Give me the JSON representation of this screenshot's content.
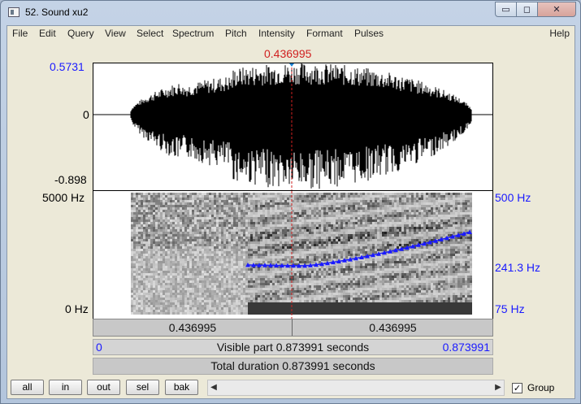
{
  "window": {
    "title": "52. Sound xu2",
    "buttons": {
      "minimize": "▭",
      "maximize": "◻",
      "close": "✕"
    }
  },
  "menu": {
    "items": [
      "File",
      "Edit",
      "Query",
      "View",
      "Select",
      "Spectrum",
      "Pitch",
      "Intensity",
      "Formant",
      "Pulses"
    ],
    "help": "Help"
  },
  "waveform": {
    "cursor_time": "0.436995",
    "y_max": "0.5731",
    "y_zero": "0",
    "y_min": "-0.898"
  },
  "spectrogram": {
    "freq_top": "5000 Hz",
    "freq_bottom": "0 Hz",
    "pitch_top": "500 Hz",
    "pitch_mid": "241.3 Hz",
    "pitch_bottom": "75 Hz"
  },
  "selection_bar": {
    "left": "0.436995",
    "right": "0.436995"
  },
  "visible_bar": {
    "start": "0",
    "text": "Visible part 0.873991 seconds",
    "end": "0.873991"
  },
  "total_bar": {
    "text": "Total duration 0.873991 seconds"
  },
  "toolbar": {
    "buttons": [
      "all",
      "in",
      "out",
      "sel",
      "bak"
    ],
    "group_label": "Group",
    "group_checked": "✓",
    "scroll_left": "◀",
    "scroll_right": "▶"
  },
  "colors": {
    "pitch": "#1a1aff",
    "cursor": "#d02020",
    "axis_blue": "#1a1aff"
  }
}
